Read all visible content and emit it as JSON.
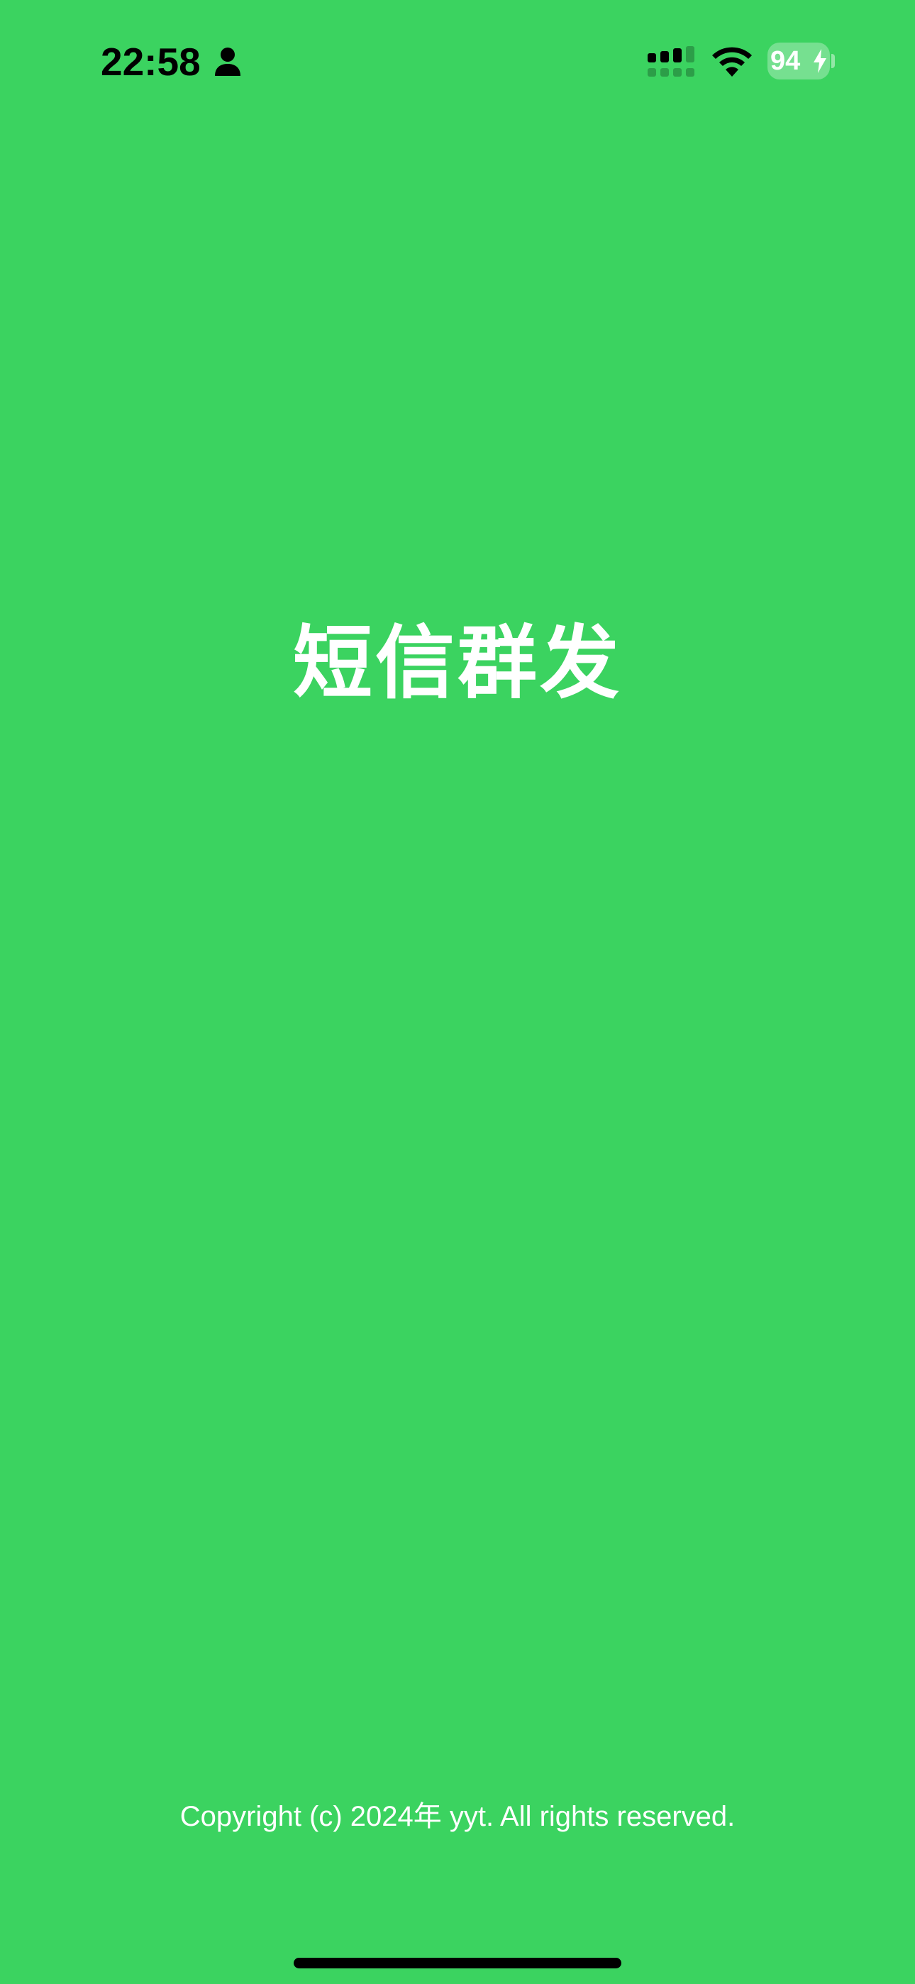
{
  "status_bar": {
    "time": "22:58",
    "battery_percent": "94",
    "battery_level": 0.94,
    "charging": true,
    "icons": [
      "person-icon",
      "cellular-signal-icon",
      "wifi-icon",
      "battery-icon",
      "charging-bolt-icon"
    ]
  },
  "splash": {
    "app_title": "短信群发",
    "copyright": "Copyright (c) 2024年 yyt. All rights reserved."
  },
  "colors": {
    "background": "#3bd360",
    "title_text": "#ffffff",
    "status_text": "#000000",
    "home_indicator": "#000000"
  }
}
